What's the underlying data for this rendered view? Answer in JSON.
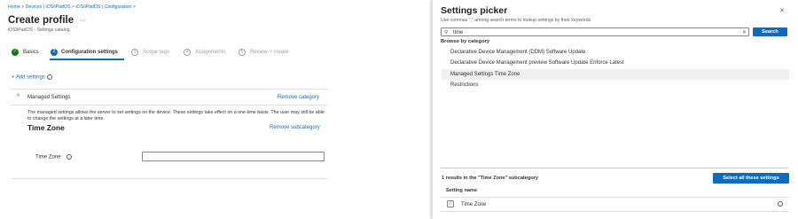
{
  "breadcrumb": [
    "Home",
    "Devices | iOS/iPadOS",
    "iOS/iPadOS | Configuration"
  ],
  "page": {
    "title": "Create profile",
    "more_label": "···",
    "subtitle": "iOS/iPadOS - Settings catalog"
  },
  "steps": [
    {
      "num": "✓",
      "label": "Basics"
    },
    {
      "num": "2",
      "label": "Configuration settings"
    },
    {
      "num": "3",
      "label": "Scope tags"
    },
    {
      "num": "4",
      "label": "Assignments"
    },
    {
      "num": "5",
      "label": "Review + create"
    }
  ],
  "add_settings_label": "+ Add settings",
  "section": {
    "chevron": "^",
    "title": "Managed Settings",
    "remove_category": "Remove category",
    "description": "The managed settings allows the server to set settings on the device. These settings take effect on a one-time basis. The user may still be able to change the settings at a later time.",
    "subcategory_title": "Time Zone",
    "remove_subcategory": "Remove subcategory",
    "field_label": "Time Zone",
    "field_value": ""
  },
  "picker": {
    "title": "Settings picker",
    "close_label": "✕",
    "hint": "Use commas \",\" among search terms to lookup settings by their keywords",
    "search_value": "time",
    "clear_label": "✕",
    "search_button": "Search",
    "browse_label": "Browse by category",
    "categories": [
      "Declarative Device Management (DDM) Software Update",
      "Declarative Device Management preview Software Update Enforce Latest",
      "Managed Settings Time Zone",
      "Restrictions"
    ],
    "results_text": "1 results in the \"Time Zone\" subcategory",
    "select_all_button": "Select all these settings",
    "column_header": "Setting name",
    "result_setting": "Time Zone"
  },
  "colors": {
    "accent": "#0f6cbd",
    "success": "#107c10"
  }
}
